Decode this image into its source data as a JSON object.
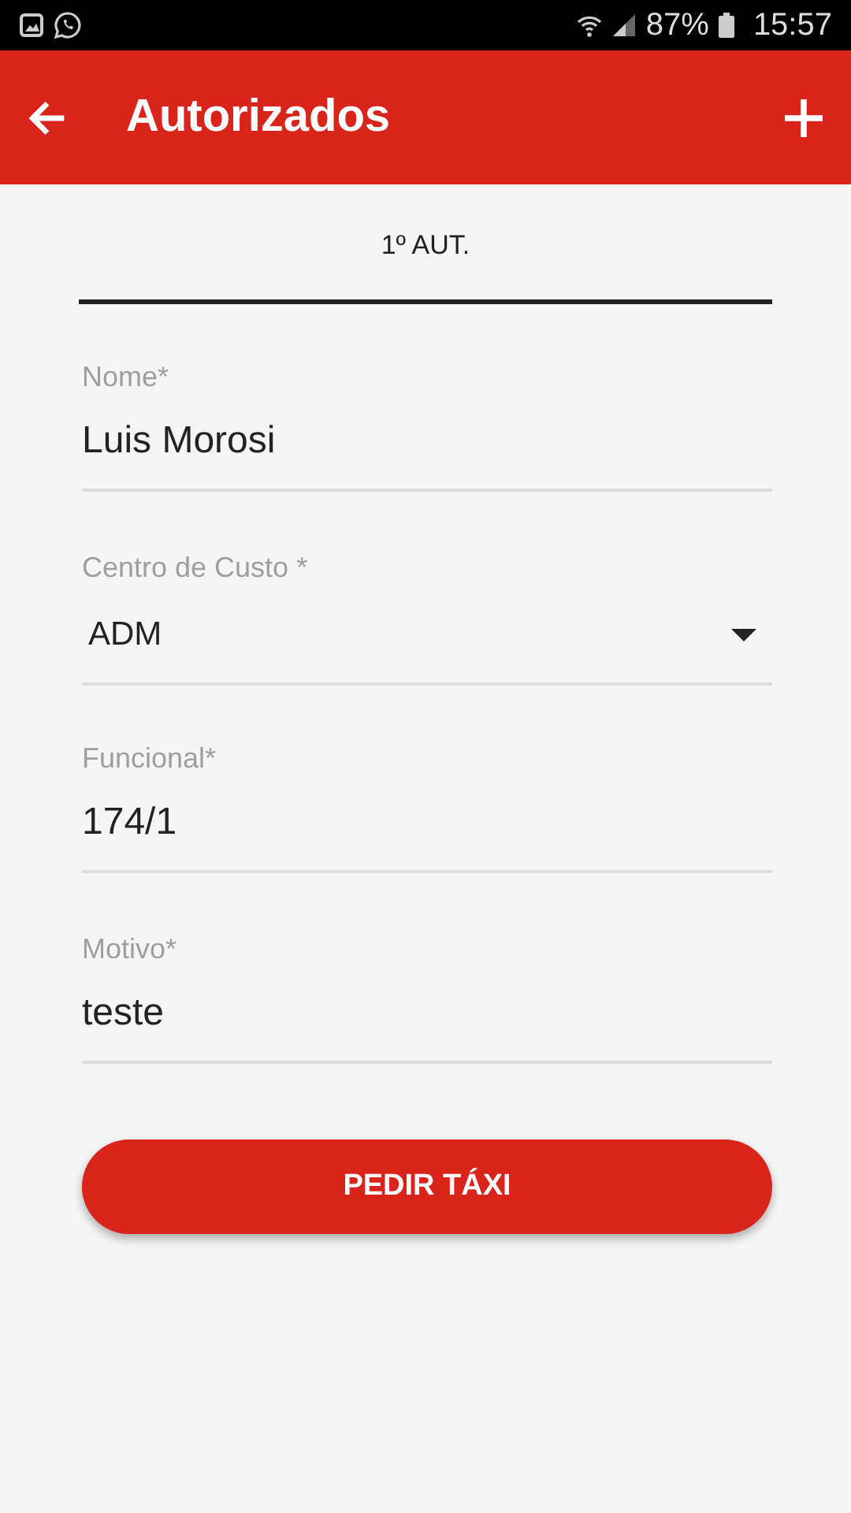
{
  "status_bar": {
    "battery": "87%",
    "time": "15:57"
  },
  "app_bar": {
    "title": "Autorizados"
  },
  "tabs": [
    {
      "label": "1º AUT.",
      "selected": true
    }
  ],
  "fields": [
    {
      "kind": "text",
      "label": "Nome*",
      "value": "Luis Morosi"
    },
    {
      "kind": "select",
      "label": "Centro de Custo *",
      "value": "ADM"
    },
    {
      "kind": "text",
      "label": "Funcional*",
      "value": "174/1"
    },
    {
      "kind": "text",
      "label": "Motivo*",
      "value": "teste"
    }
  ],
  "submit_button": {
    "label": "PEDIR TÁXI"
  }
}
